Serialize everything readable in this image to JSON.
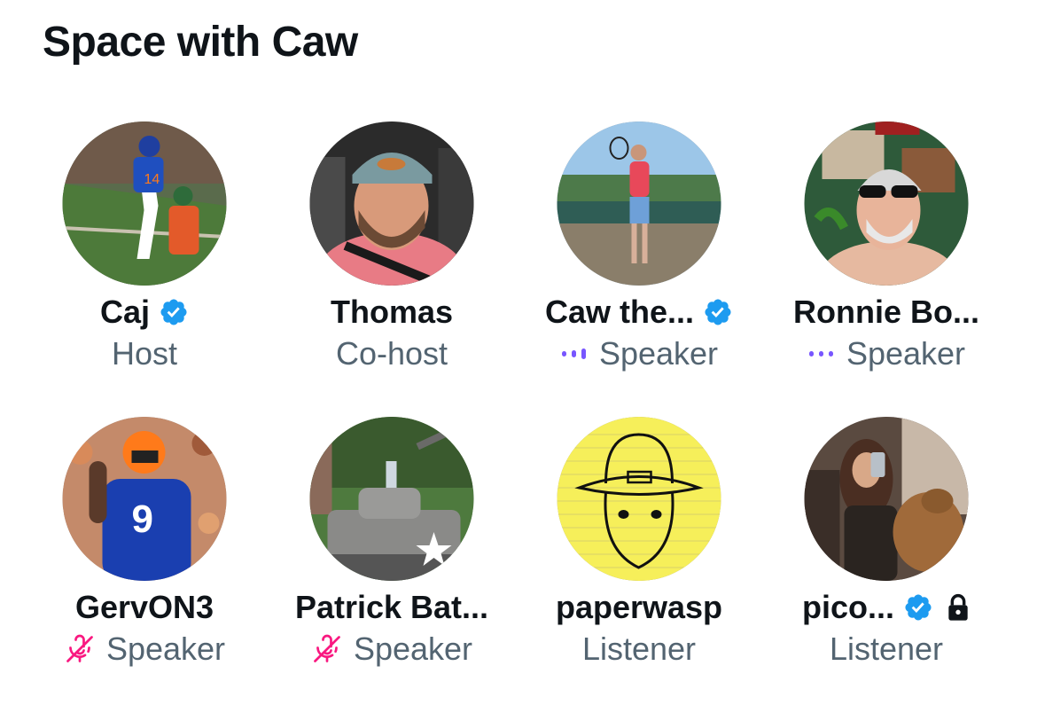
{
  "title": "Space with Caw",
  "participants": [
    {
      "name": "Caj",
      "role": "Host",
      "verified": true
    },
    {
      "name": "Thomas",
      "role": "Co-host",
      "verified": false
    },
    {
      "name": "Caw the...",
      "role": "Speaker",
      "verified": true,
      "status_icon": "speaking-dots-icon"
    },
    {
      "name": "Ronnie Bo...",
      "role": "Speaker",
      "verified": false,
      "status_icon": "speaking-dots-icon"
    },
    {
      "name": "GervON3",
      "role": "Speaker",
      "verified": false,
      "status_icon": "mic-muted-icon"
    },
    {
      "name": "Patrick Bat...",
      "role": "Speaker",
      "verified": false,
      "status_icon": "mic-muted-icon"
    },
    {
      "name": "paperwasp",
      "role": "Listener",
      "verified": false
    },
    {
      "name": "pico...",
      "role": "Listener",
      "verified": true,
      "locked": true
    }
  ],
  "colors": {
    "verified": "#1d9bf0",
    "speaking": "#7856ff",
    "muted": "#f91880",
    "secondary_text": "#536471"
  }
}
